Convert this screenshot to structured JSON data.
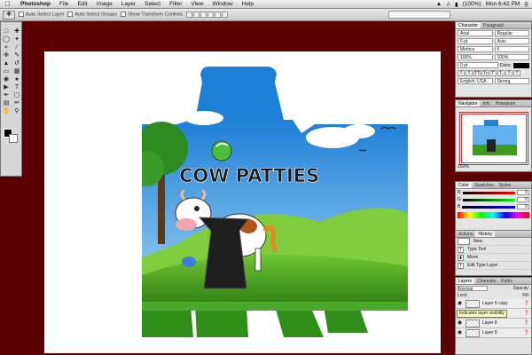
{
  "menubar": {
    "items": [
      "Photoshop",
      "File",
      "Edit",
      "Image",
      "Layer",
      "Select",
      "Filter",
      "View",
      "Window",
      "Help"
    ],
    "battery": "(100%)",
    "clock": "Mon 6:42 PM"
  },
  "options_bar": {
    "auto_select_label": "Auto Select Layer",
    "auto_select_groups_label": "Auto Select Groups",
    "show_transform_label": "Show Transform Controls"
  },
  "character": {
    "tabs": [
      "Character",
      "Paragraph"
    ],
    "font_family": "Arial",
    "font_style": "Regular",
    "size": "6 pt",
    "leading": "Auto",
    "kerning": "Metrics",
    "tracking": "0",
    "vscale": "100%",
    "hscale": "100%",
    "baseline": "0 pt",
    "color_label": "Color:",
    "language": "English: USA",
    "antialias": "Strong",
    "style_buttons": [
      "T",
      "T",
      "TT",
      "Tr",
      "T'",
      "T,",
      "T",
      "T"
    ]
  },
  "navigator": {
    "tabs": [
      "Navigator",
      "Info",
      "Histogram"
    ],
    "zoom": "150%"
  },
  "color_panel": {
    "tabs": [
      "Color",
      "Swatches",
      "Styles"
    ],
    "channels": [
      {
        "label": "R",
        "value": "0"
      },
      {
        "label": "G",
        "value": "0"
      },
      {
        "label": "B",
        "value": "0"
      }
    ]
  },
  "history": {
    "tabs": [
      "Actions",
      "History"
    ],
    "items": [
      "New",
      "Type Tool",
      "Move",
      "Edit Type Layer"
    ]
  },
  "layers": {
    "tabs": [
      "Layers",
      "Channels",
      "Paths"
    ],
    "blend_mode": "Normal",
    "opacity_label": "Opacity:",
    "lock_label": "Lock:",
    "fill_label": "Fill:",
    "rows": [
      {
        "name": "Layer 5 copy"
      },
      {
        "name": "Layer 5"
      },
      {
        "name": "Layer 8"
      },
      {
        "name": "Layer 8"
      }
    ],
    "tooltip": "Indicates layer visibility"
  },
  "artwork": {
    "title": "COW PATTIES"
  },
  "colors": {
    "pasteboard": "#5c0000",
    "sky": "#3fa0e6",
    "grass": "#3f9a1e",
    "tab_blue": "#1e7fd8"
  }
}
